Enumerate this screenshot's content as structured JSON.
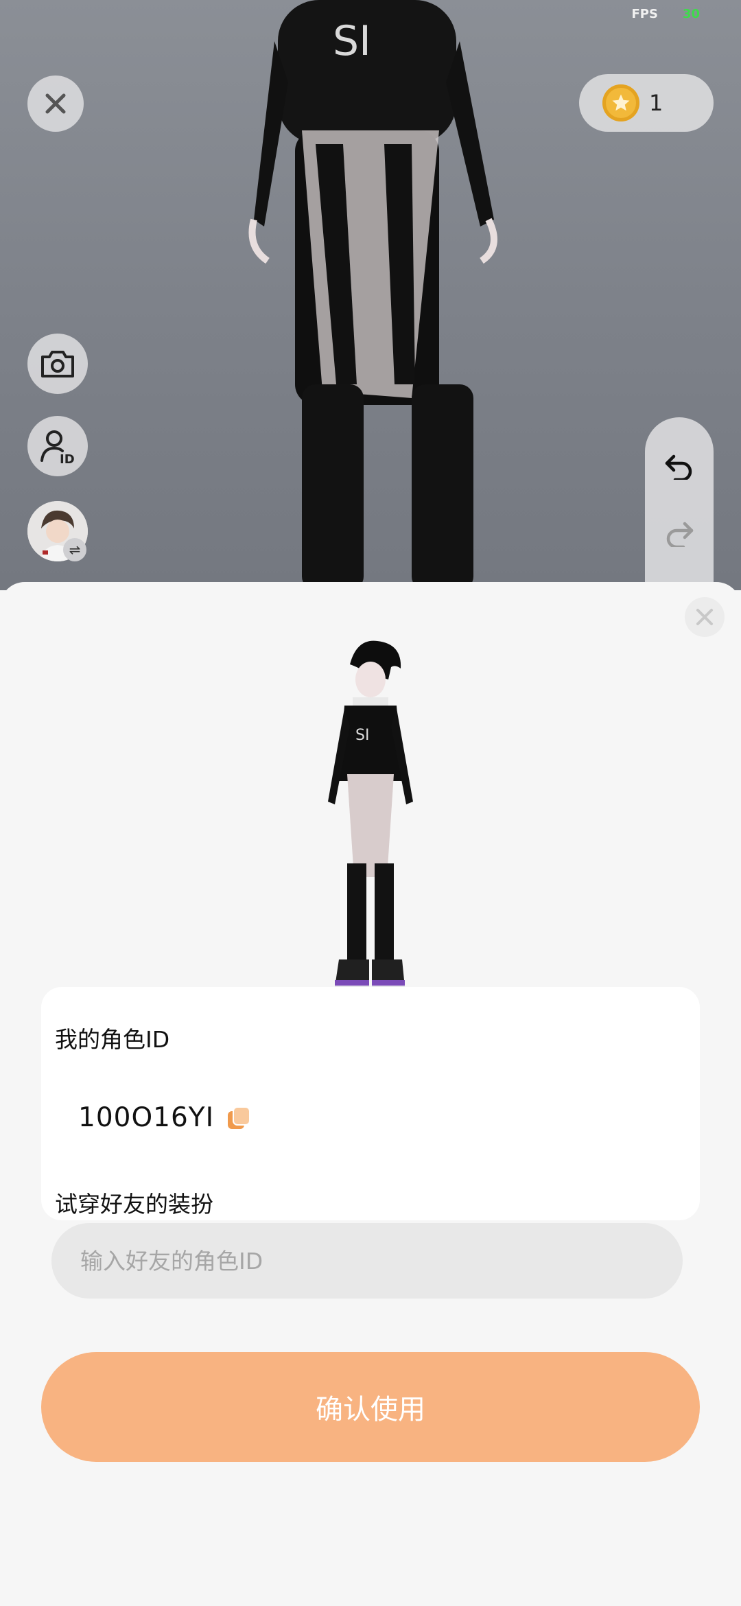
{
  "status": {
    "fps_label": "FPS",
    "fps_value": "30"
  },
  "viewport": {
    "coins": "1",
    "icons": {
      "close": "close-icon",
      "coin": "star-coin-icon",
      "camera": "camera-icon",
      "profile_id": "person-id-icon",
      "avatar": "avatar-thumbnail",
      "swap": "swap-icon",
      "undo": "undo-icon",
      "redo": "redo-icon"
    }
  },
  "sheet": {
    "my_id_label": "我的角色ID",
    "my_id_value": "100O16YI",
    "try_on_label": "试穿好友的装扮",
    "friend_id_placeholder": "输入好友的角色ID",
    "friend_id_value": "",
    "confirm_label": "确认使用"
  },
  "colors": {
    "accent": "#f8b381",
    "copy_icon": "#f09a4c",
    "fps_value": "#3ddc4a",
    "coin": "#f2b93a"
  }
}
